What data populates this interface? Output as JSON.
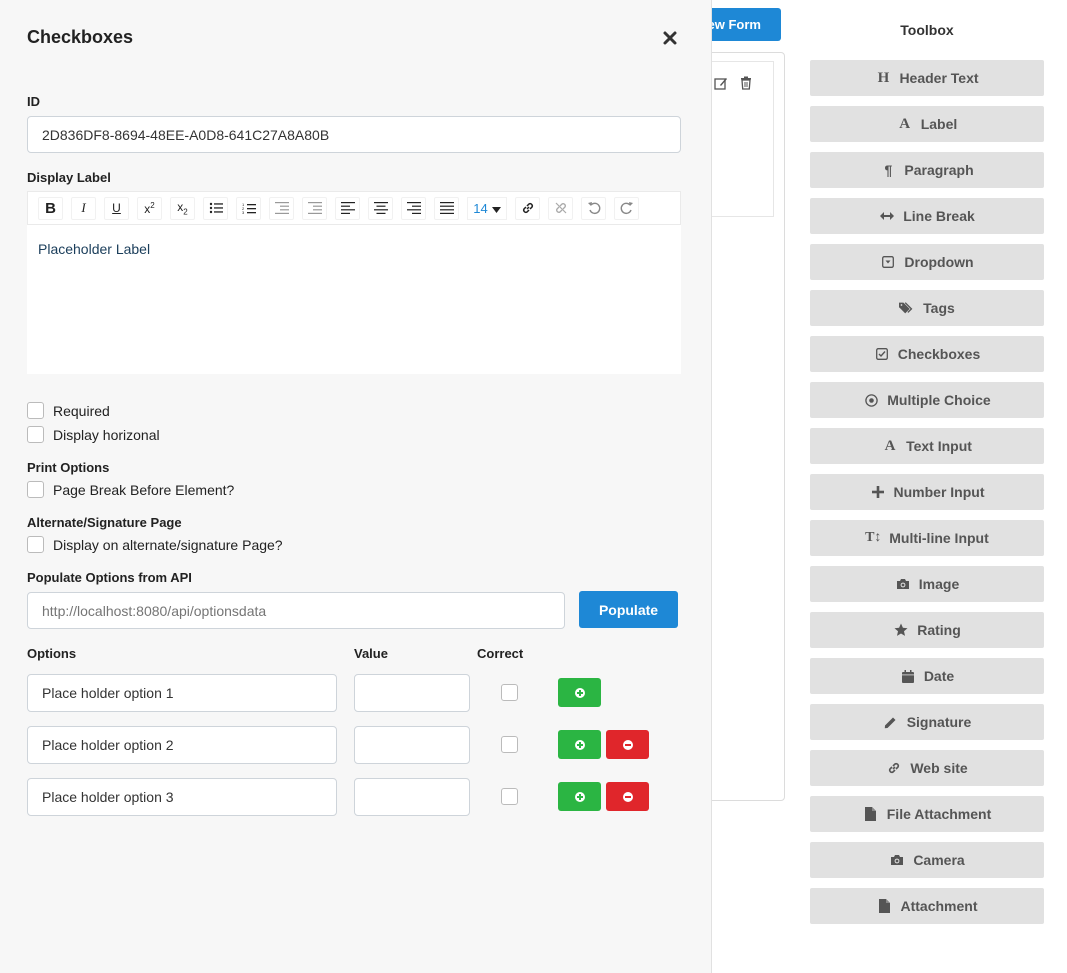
{
  "background": {
    "preview_button_label": "ew Form"
  },
  "toolbox": {
    "title": "Toolbox",
    "items": [
      {
        "label": "Header Text",
        "icon": "header-icon"
      },
      {
        "label": "Label",
        "icon": "font-icon"
      },
      {
        "label": "Paragraph",
        "icon": "paragraph-icon"
      },
      {
        "label": "Line Break",
        "icon": "arrows-h-icon"
      },
      {
        "label": "Dropdown",
        "icon": "caret-square-down-icon"
      },
      {
        "label": "Tags",
        "icon": "tags-icon"
      },
      {
        "label": "Checkboxes",
        "icon": "check-square-icon"
      },
      {
        "label": "Multiple Choice",
        "icon": "dot-circle-icon"
      },
      {
        "label": "Text Input",
        "icon": "font-icon"
      },
      {
        "label": "Number Input",
        "icon": "plus-icon"
      },
      {
        "label": "Multi-line Input",
        "icon": "text-height-icon"
      },
      {
        "label": "Image",
        "icon": "camera-icon"
      },
      {
        "label": "Rating",
        "icon": "star-icon"
      },
      {
        "label": "Date",
        "icon": "calendar-icon"
      },
      {
        "label": "Signature",
        "icon": "pencil-icon"
      },
      {
        "label": "Web site",
        "icon": "link-icon"
      },
      {
        "label": "File Attachment",
        "icon": "file-icon"
      },
      {
        "label": "Camera",
        "icon": "camera-icon"
      },
      {
        "label": "Attachment",
        "icon": "file-icon"
      }
    ]
  },
  "modal": {
    "title": "Checkboxes",
    "id_label": "ID",
    "id_value": "2D836DF8-8694-48EE-A0D8-641C27A8A80B",
    "display_label_label": "Display Label",
    "font_size": "14",
    "editor_content": "Placeholder Label",
    "required_label": "Required",
    "horizontal_label": "Display horizonal",
    "print_options_label": "Print Options",
    "page_break_label": "Page Break Before Element?",
    "alternate_label": "Alternate/Signature Page",
    "alternate_check_label": "Display on alternate/signature Page?",
    "populate_label": "Populate Options from API",
    "populate_placeholder": "http://localhost:8080/api/optionsdata",
    "populate_button": "Populate",
    "options_header": "Options",
    "value_header": "Value",
    "correct_header": "Correct",
    "options": [
      {
        "text": "Place holder option 1",
        "value": ""
      },
      {
        "text": "Place holder option 2",
        "value": ""
      },
      {
        "text": "Place holder option 3",
        "value": ""
      }
    ]
  }
}
